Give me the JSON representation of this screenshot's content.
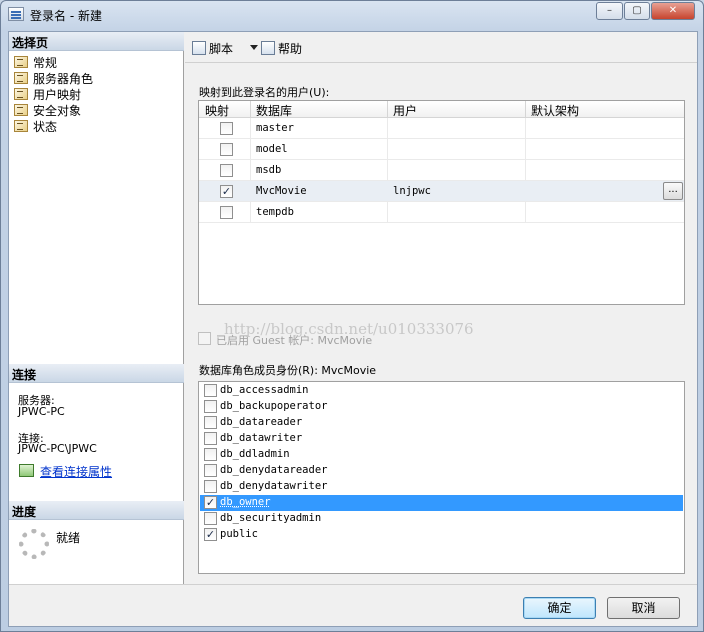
{
  "window": {
    "title": "登录名 - 新建",
    "controls": [
      "–",
      "▢",
      "✕"
    ]
  },
  "left": {
    "select_page_header": "选择页",
    "pages": [
      "常规",
      "服务器角色",
      "用户映射",
      "安全对象",
      "状态"
    ],
    "connection_header": "连接",
    "server_label": "服务器:",
    "server_value": "JPWC-PC",
    "connection_label": "连接:",
    "connection_value": "JPWC-PC\\JPWC",
    "view_props_link": "查看连接属性",
    "progress_header": "进度",
    "progress_status": "就绪"
  },
  "toolbar": {
    "script_label": "脚本",
    "help_label": "帮助"
  },
  "mapping": {
    "label": "映射到此登录名的用户(U):",
    "columns": [
      "映射",
      "数据库",
      "用户",
      "默认架构"
    ],
    "rows": [
      {
        "mapped": false,
        "database": "master",
        "user": ""
      },
      {
        "mapped": false,
        "database": "model",
        "user": ""
      },
      {
        "mapped": false,
        "database": "msdb",
        "user": ""
      },
      {
        "mapped": true,
        "database": "MvcMovie",
        "user": "lnjpwc"
      },
      {
        "mapped": false,
        "database": "tempdb",
        "user": ""
      }
    ],
    "ellipsis": "..."
  },
  "guest": {
    "label": "已启用 Guest 帐户: MvcMovie"
  },
  "watermark": "http://blog.csdn.net/u010333076",
  "roles": {
    "label": "数据库角色成员身份(R): MvcMovie",
    "items": [
      {
        "name": "db_accessadmin",
        "checked": false
      },
      {
        "name": "db_backupoperator",
        "checked": false
      },
      {
        "name": "db_datareader",
        "checked": false
      },
      {
        "name": "db_datawriter",
        "checked": false
      },
      {
        "name": "db_ddladmin",
        "checked": false
      },
      {
        "name": "db_denydatareader",
        "checked": false
      },
      {
        "name": "db_denydatawriter",
        "checked": false
      },
      {
        "name": "db_owner",
        "checked": true
      },
      {
        "name": "db_securityadmin",
        "checked": false
      },
      {
        "name": "public",
        "checked": true
      }
    ]
  },
  "buttons": {
    "ok": "确定",
    "cancel": "取消"
  }
}
